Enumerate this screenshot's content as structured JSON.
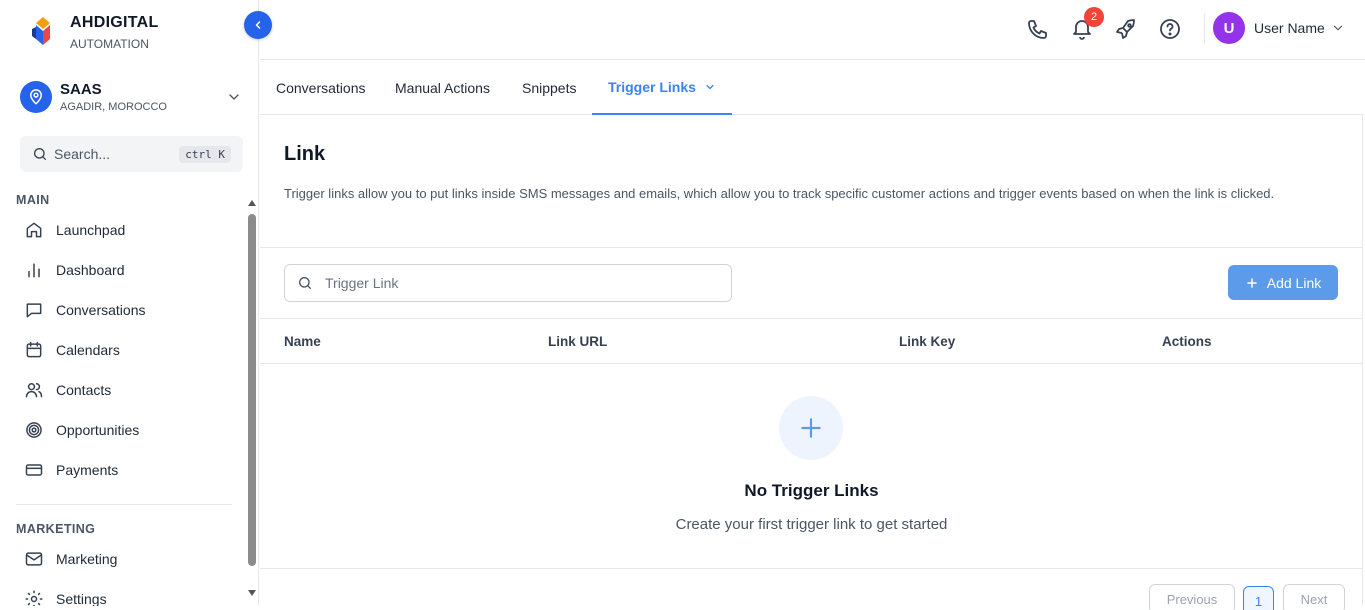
{
  "brand": {
    "name": "AHDIGITAL",
    "subtitle": "AUTOMATION"
  },
  "account": {
    "name": "SAAS",
    "location": "AGADIR, MOROCCO"
  },
  "search": {
    "placeholder": "Search...",
    "shortcut": "ctrl K"
  },
  "sidebar": {
    "sections": [
      {
        "title": "MAIN"
      },
      {
        "title": "MARKETING"
      }
    ],
    "items": [
      {
        "label": "Launchpad",
        "icon": "home-icon"
      },
      {
        "label": "Dashboard",
        "icon": "bar-chart-icon"
      },
      {
        "label": "Conversations",
        "icon": "chat-icon"
      },
      {
        "label": "Calendars",
        "icon": "calendar-icon"
      },
      {
        "label": "Contacts",
        "icon": "users-icon"
      },
      {
        "label": "Opportunities",
        "icon": "target-icon"
      },
      {
        "label": "Payments",
        "icon": "credit-card-icon"
      },
      {
        "label": "Marketing",
        "icon": "mail-icon"
      },
      {
        "label": "Settings",
        "icon": "gear-icon"
      }
    ]
  },
  "header": {
    "notification_count": "2",
    "user_initial": "U",
    "user_name": "User Name"
  },
  "tabs": [
    {
      "label": "Conversations",
      "active": false
    },
    {
      "label": "Manual Actions",
      "active": false
    },
    {
      "label": "Snippets",
      "active": false
    },
    {
      "label": "Trigger Links",
      "active": true
    }
  ],
  "main": {
    "title": "Link",
    "description": "Trigger links allow you to put links inside SMS messages and emails, which allow you to track specific customer actions and trigger events based on when the link is clicked.",
    "filter_placeholder": "Trigger Link",
    "add_button": "Add Link",
    "columns": [
      "Name",
      "Link URL",
      "Link Key",
      "Actions"
    ],
    "empty": {
      "title": "No Trigger Links",
      "subtitle": "Create your first trigger link to get started"
    },
    "pagination": {
      "previous": "Previous",
      "current": "1",
      "next": "Next"
    }
  },
  "colors": {
    "accent": "#3b82f6",
    "primary_button": "#5b9bea",
    "badge": "#f04438",
    "avatar": "#9333ea"
  }
}
